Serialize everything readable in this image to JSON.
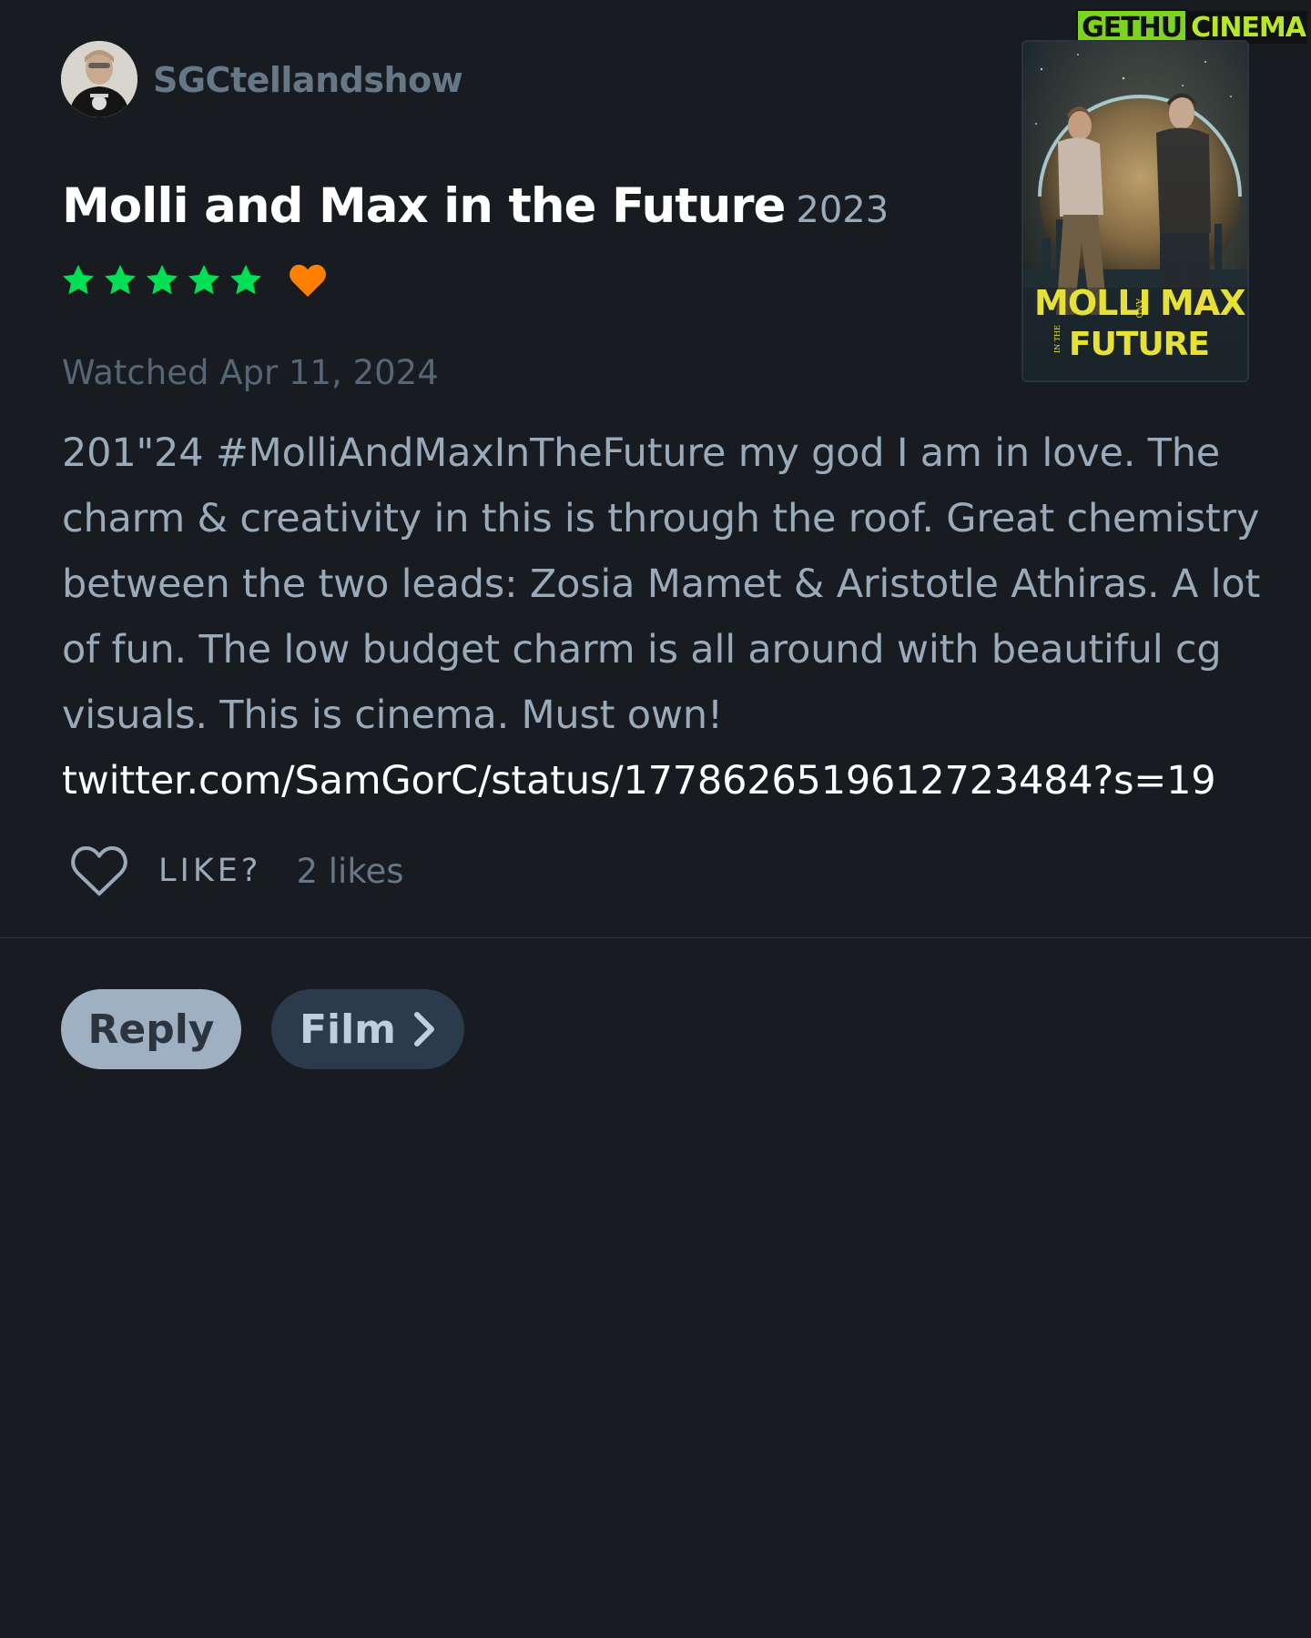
{
  "watermark": {
    "part_a": "GETHU",
    "part_b": "CINEMA"
  },
  "user": {
    "username": "SGCtellandshow"
  },
  "film": {
    "title": "Molli and Max in the Future",
    "year": "2023",
    "rating_stars": 5,
    "liked": true,
    "poster": {
      "title_top": "MOLLI",
      "title_and": "AND",
      "title_max": "MAX",
      "title_inthe": "IN THE",
      "title_bottom": "FUTURE"
    }
  },
  "review": {
    "watched_label": "Watched Apr 11, 2024",
    "body": "201\"24 #MolliAndMaxInTheFuture my god I am in love. The charm & creativity in this is through the roof. Great chemistry between the two leads: Zosia Mamet & Aristotle Athiras. A lot of fun. The low budget charm is all around with beautiful cg visuals. This is cinema. Must own!",
    "link": "twitter.com/SamGorC/status/1778626519612723484?s=19"
  },
  "actions": {
    "like_label": "LIKE?",
    "likes_count": "2 likes",
    "reply_label": "Reply",
    "film_label": "Film"
  },
  "colors": {
    "background": "#181b1f",
    "star_green": "#00e054",
    "heart_orange": "#ff8000",
    "text_muted": "#99aabb"
  }
}
